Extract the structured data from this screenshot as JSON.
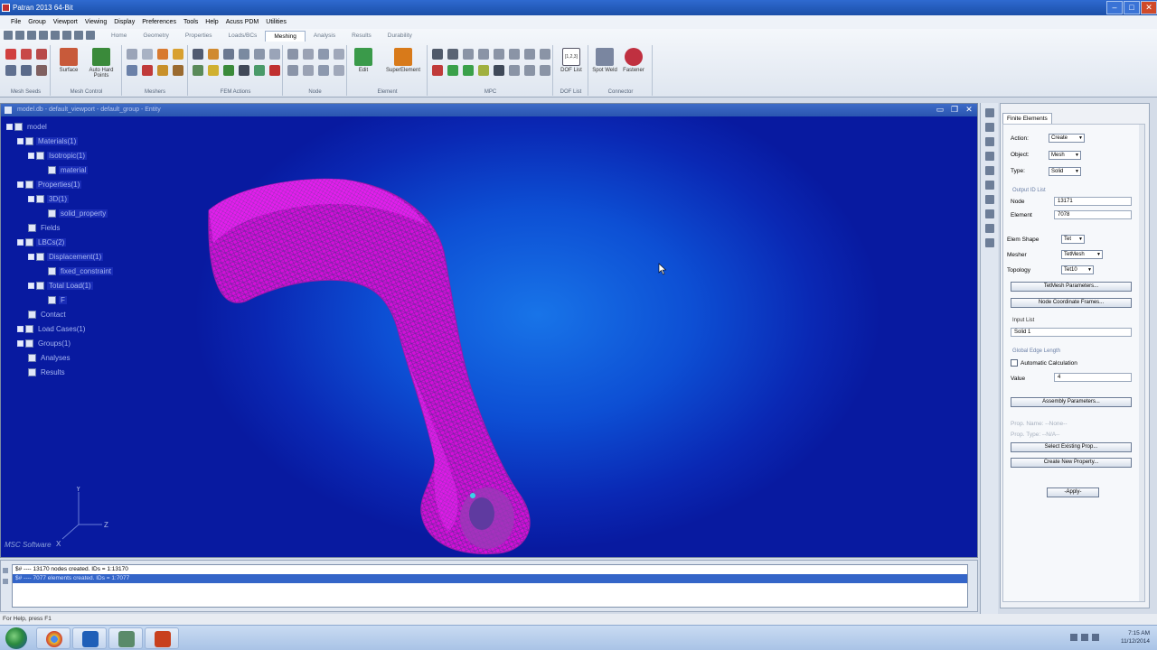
{
  "window": {
    "title": "Patran 2013 64-Bit",
    "buttons": {
      "minimize": "–",
      "maximize": "□",
      "close": "✕"
    }
  },
  "menu": [
    "File",
    "Group",
    "Viewport",
    "Viewing",
    "Display",
    "Preferences",
    "Tools",
    "Help",
    "Acuss PDM",
    "Utilities"
  ],
  "ribbon": {
    "tabs": [
      "Home",
      "Geometry",
      "Properties",
      "Loads/BCs",
      "Meshing",
      "Analysis",
      "Results",
      "Durability"
    ],
    "active_tab": "Meshing",
    "groups": {
      "mesh_seeds": "Mesh Seeds",
      "mesh_control": "Mesh Control",
      "meshers": "Meshers",
      "fem_actions": "FEM Actions",
      "node": "Node",
      "element": "Element",
      "mpc": "MPC",
      "dof_list": "DOF List",
      "connector": "Connector"
    },
    "buttons": {
      "surface": "Surface",
      "auto_hard_points": "Auto Hard Points",
      "edit": "Edit",
      "superelement": "SuperElement",
      "dof_list": "DOF List",
      "spot_weld": "Spot Weld",
      "fastener": "Fastener",
      "dof_icon_text": "[1,2,3]"
    }
  },
  "viewport": {
    "title": "model.db - default_viewport - default_group - Entity",
    "controls": {
      "minimize": "▭",
      "restore": "❐",
      "close": "✕"
    }
  },
  "tree": {
    "model": "model",
    "materials": "Materials(1)",
    "isotropic": "Isotropic(1)",
    "material": "material",
    "properties": "Properties(1)",
    "solid3d": "3D(1)",
    "solid_property": "solid_property",
    "fields": "Fields",
    "lbcs": "LBCs(2)",
    "displacement": "Displacement(1)",
    "fixed_constraint": "fixed_constraint",
    "total_load": "Total Load(1)",
    "f": "F",
    "contact": "Contact",
    "load_cases": "Load Cases(1)",
    "groups": "Groups(1)",
    "analyses": "Analyses",
    "results": "Results"
  },
  "axes": {
    "y": "Y",
    "z": "Z",
    "x": "X"
  },
  "brand": "MSC Software",
  "messages": [
    "$# ---- 13170 nodes created.  IDs = 1:13170",
    "$# ---- 7077 elements created.  IDs = 1:7077"
  ],
  "status": "For Help, press F1",
  "panel": {
    "tab": "Finite Elements",
    "action_label": "Action:",
    "action_value": "Create",
    "object_label": "Object:",
    "object_value": "Mesh",
    "type_label": "Type:",
    "type_value": "Solid",
    "output_id_list": "Output ID List",
    "node_label": "Node",
    "node_value": "13171",
    "element_label": "Element",
    "element_value": "7078",
    "elem_shape_label": "Elem Shape",
    "elem_shape_value": "Tet",
    "mesher_label": "Mesher",
    "mesher_value": "TetMesh",
    "topology_label": "Topology",
    "topology_value": "Tet10",
    "tetmesh_params": "TetMesh Parameters...",
    "node_coord_frames": "Node Coordinate Frames...",
    "input_list_label": "Input List",
    "input_list_value": "Solid 1",
    "global_edge_length": "Global Edge Length",
    "auto_calc": "Automatic Calculation",
    "value_label": "Value",
    "value_value": "4",
    "assembly_params": "Assembly Parameters...",
    "prop_name": "Prop. Name:      --None--",
    "prop_type": "Prop. Type:      --N/A--",
    "select_existing_prop": "Select Existing Prop...",
    "create_new_property": "Create New Property...",
    "apply": "-Apply-"
  },
  "clock": {
    "time": "7:15 AM",
    "date": "11/12/2014"
  },
  "colors": {
    "mesh": "#e010e6",
    "viewport_bg": "#0d4fd4",
    "title_blue": "#1b4fa8"
  }
}
